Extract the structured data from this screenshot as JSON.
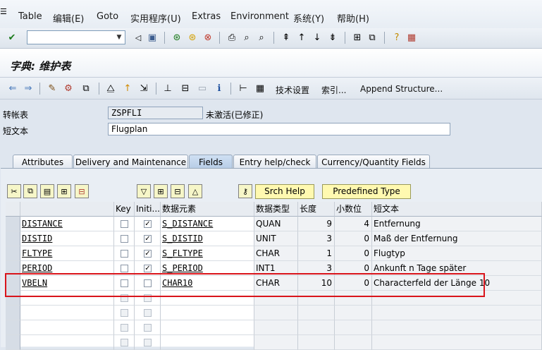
{
  "menubar": {
    "items": [
      "Table",
      "编辑(E)",
      "Goto",
      "实用程序(U)",
      "Extras",
      "Environment",
      "系统(Y)",
      "帮助(H)"
    ]
  },
  "title": "字典: 维护表",
  "app_toolbar": {
    "tech_settings": "技术设置",
    "index": "索引...",
    "append_structure": "Append Structure..."
  },
  "header_fields": {
    "table_label": "转帐表",
    "table_value": "ZSPFLI",
    "status": "未激活(已修正)",
    "short_text_label": "短文本",
    "short_text_value": "Flugplan"
  },
  "tabs": [
    "Attributes",
    "Delivery and Maintenance",
    "Fields",
    "Entry help/check",
    "Currency/Quantity Fields"
  ],
  "active_tab": "Fields",
  "table_toolbar": {
    "srch_help": "Srch Help",
    "predefined_type": "Predefined Type"
  },
  "grid": {
    "columns": [
      "",
      "Key",
      "Initi...",
      "数据元素",
      "数据类型",
      "长度",
      "小数位",
      "短文本"
    ],
    "rows": [
      {
        "field": "DISTANCE",
        "key": false,
        "init": true,
        "element": "S_DISTANCE",
        "type": "QUAN",
        "length": "9",
        "decimals": "4",
        "text": "Entfernung"
      },
      {
        "field": "DISTID",
        "key": false,
        "init": true,
        "element": "S_DISTID",
        "type": "UNIT",
        "length": "3",
        "decimals": "0",
        "text": "Maß der Entfernung"
      },
      {
        "field": "FLTYPE",
        "key": false,
        "init": true,
        "element": "S_FLTYPE",
        "type": "CHAR",
        "length": "1",
        "decimals": "0",
        "text": "Flugtyp"
      },
      {
        "field": "PERIOD",
        "key": false,
        "init": true,
        "element": "S_PERIOD",
        "type": "INT1",
        "length": "3",
        "decimals": "0",
        "text": "Ankunft n Tage später"
      },
      {
        "field": "VBELN",
        "key": false,
        "init": false,
        "element": "CHAR10",
        "type": "CHAR",
        "length": "10",
        "decimals": "0",
        "text": "Characterfeld der Länge 10"
      }
    ],
    "empty_rows": 4
  },
  "colors": {
    "highlight": "#d9141b",
    "button_yellow": "#fff9b0",
    "tab_active": "#b7cde6"
  }
}
